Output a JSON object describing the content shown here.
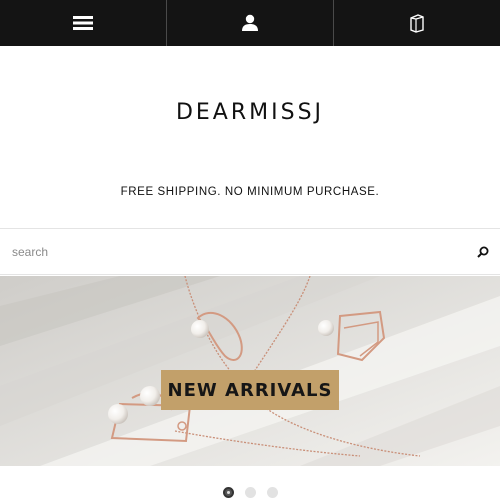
{
  "topbar": {
    "items": [
      {
        "icon": "menu-icon"
      },
      {
        "icon": "user-icon"
      },
      {
        "icon": "shopping-bag-icon"
      }
    ]
  },
  "brand": {
    "name": "DEARMISSJ"
  },
  "promo": {
    "text": "FREE SHIPPING. NO MINIMUM PURCHASE."
  },
  "search": {
    "placeholder": "search",
    "button_icon": "search-icon"
  },
  "hero": {
    "cta_label": "NEW ARRIVALS",
    "accent_color": "#c2a06a"
  },
  "carousel": {
    "slide_count": 3,
    "active_index": 0
  },
  "colors": {
    "topbar_bg": "#141414",
    "text": "#111111"
  }
}
